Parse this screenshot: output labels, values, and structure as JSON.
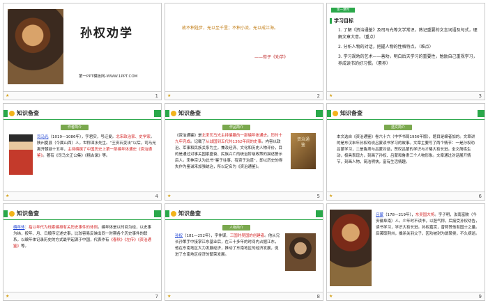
{
  "slides": [
    {
      "num": "1",
      "title": "孙权劝学",
      "site": "第一PPT模板网-WWW.1PPT.COM"
    },
    {
      "num": "2",
      "quote": "故不积跬步，无以至千里；不积小流，无以成江海。",
      "source": "——荀子《劝学》"
    },
    {
      "num": "3",
      "badge": "第一课时",
      "goal_title": "学习目标",
      "items": [
        "1. 了解《资治通鉴》及司马光等文学常识，熟记重要的文言词语及句式，理解文章大意。（重点）",
        "2. 分析人物的对话，把握人物的性格特点。（难点）",
        "3. 学习规劝的艺术——善劝，明白后天学习的重要性，勉励自己重视学习，养成读书的好习惯。（素养）"
      ]
    },
    {
      "num": "4",
      "header": "知识备查",
      "tag": "作者简介",
      "text_parts": [
        {
          "t": "司马光",
          "style": "blue"
        },
        {
          "t": "（1019—1086年），字君实，号迂叟。",
          "style": ""
        },
        {
          "t": "北宋政治家、史学家",
          "style": "red"
        },
        {
          "t": "。陕州夏县（今属山西）人，世称涑水先生。“王安石变法”以后，司马光离开朝廷十五年，",
          "style": ""
        },
        {
          "t": "主持编撰了中国历史上第一部编年体通史《资治通鉴》",
          "style": "red"
        },
        {
          "t": "。著有《司马文正公集》《稽古录》等。",
          "style": ""
        }
      ]
    },
    {
      "num": "5",
      "header": "知识备查",
      "tag": "作品简介",
      "portrait_label": "资治通鉴",
      "text_parts": [
        {
          "t": "《资治通鉴》是",
          "style": ""
        },
        {
          "t": "北宋司马光主持编纂的一部编年体通史",
          "style": "red"
        },
        {
          "t": "。",
          "style": ""
        },
        {
          "t": "历时十九年完成",
          "style": "red"
        },
        {
          "t": "。记载了",
          "style": ""
        },
        {
          "t": "从战国到五代共1362年间的史事",
          "style": "red"
        },
        {
          "t": "。内容以政治、军事和民族关系为主，兼及经济、文化和历史人物评价，目的是通过对事关国家盛衰、民族兴亡的统治阶级政策的描述警示后人。宋神宗认为此书“鉴于往事，有资于治道”，即以历史的得失作为鉴诫来加强统治，所以定名为《资治通鉴》。",
          "style": ""
        }
      ]
    },
    {
      "num": "6",
      "header": "知识备查",
      "tag": "选文简介",
      "text_parts": [
        {
          "t": "本文选自《资治通鉴》卷六十六（中华书局1956年版），题目是编者加的。文章讲的是东汉末年孙权劝说吕蒙读书学习的故事。文章主要写了两个情节：一是孙权劝吕蒙学习，二是鲁肃与吕蒙对话，赞叹吕蒙的学识与才略大有长进。全文简练生动，极具表现力，刻画了孙权、吕蒙和鲁肃三个人物形象。文章通过对话展开情节，刻画人物，简洁明快，富有生活情趣。",
          "style": ""
        }
      ]
    },
    {
      "num": "7",
      "header": "知识备查",
      "text_parts": [
        {
          "t": "编年体",
          "style": "blue"
        },
        {
          "t": "：",
          "style": ""
        },
        {
          "t": "指以年代为线索编排有关历史事件的体例",
          "style": "red"
        },
        {
          "t": "。编年体是以时间为经，以史事为纬，按年、月、日顺序记述史事，比较容易反映出同一时期各个历史事件的联系，以编年体记录历史的方式最早起源于中国，代表作有",
          "style": ""
        },
        {
          "t": "《春秋》《左传》《资治通鉴》",
          "style": "red"
        },
        {
          "t": "等。",
          "style": ""
        }
      ]
    },
    {
      "num": "8",
      "header": "知识备查",
      "tag": "人物简介",
      "text_parts": [
        {
          "t": "孙权",
          "style": "blue"
        },
        {
          "t": "（181—252年），字仲谋，",
          "style": ""
        },
        {
          "t": "三国时吴国的创建者",
          "style": "red"
        },
        {
          "t": "。他从兄长孙策手中接掌江东基业后，在三十多年的时间内占据江东，他在东南地区大力发展经济，推动了东南地区的经济发展，促进了东南地区经济的繁荣发展。",
          "style": ""
        }
      ]
    },
    {
      "num": "9",
      "text_parts": [
        {
          "t": "吕蒙",
          "style": "blue"
        },
        {
          "t": "（178—219年），",
          "style": ""
        },
        {
          "t": "东吴国大将",
          "style": "red"
        },
        {
          "t": "。字子明，汝南富陂（今安徽阜南）人。少年时不读书，以胆气称，后接受孙权劝告，读书学习，学识大有长进。孙权嘉赏，曾称赞他有国士之量。后袭取荆州，擒杀关羽父子，因功被封为孱陵侯，不久病逝。",
          "style": ""
        }
      ]
    }
  ]
}
